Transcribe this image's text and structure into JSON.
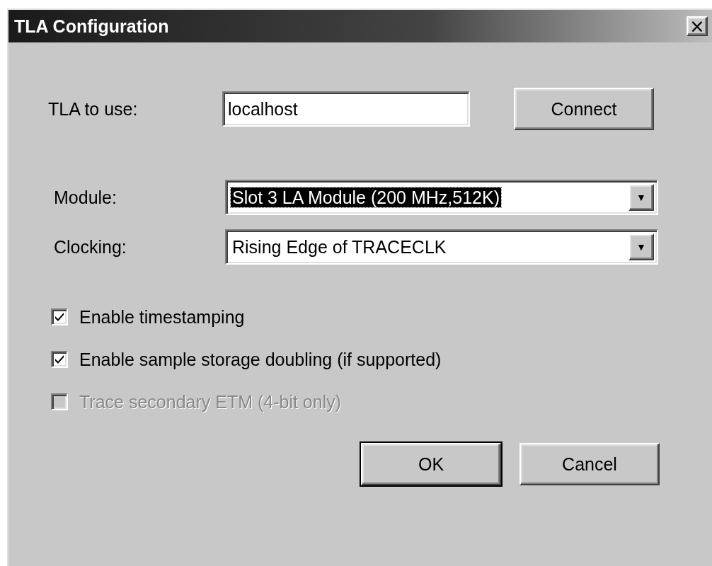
{
  "window": {
    "title": "TLA Configuration",
    "close": "×"
  },
  "tla": {
    "label": "TLA to use:",
    "value": "localhost",
    "button": "Connect"
  },
  "combos": [
    {
      "label": "Module:",
      "value": "Slot 3 LA Module (200 MHz,512K)",
      "focused": true,
      "arrow": "▼"
    },
    {
      "label": "Clocking:",
      "value": "Rising Edge of TRACECLK",
      "focused": false,
      "arrow": "▼"
    }
  ],
  "options": [
    {
      "label": "Enable timestamping",
      "checked": true,
      "disabled": false
    },
    {
      "label": "Enable sample storage doubling (if supported)",
      "checked": true,
      "disabled": false
    },
    {
      "label": "Trace secondary ETM (4-bit only)",
      "checked": false,
      "disabled": true
    }
  ],
  "buttons": [
    {
      "label": "OK",
      "default": true
    },
    {
      "label": "Cancel",
      "default": false
    }
  ]
}
